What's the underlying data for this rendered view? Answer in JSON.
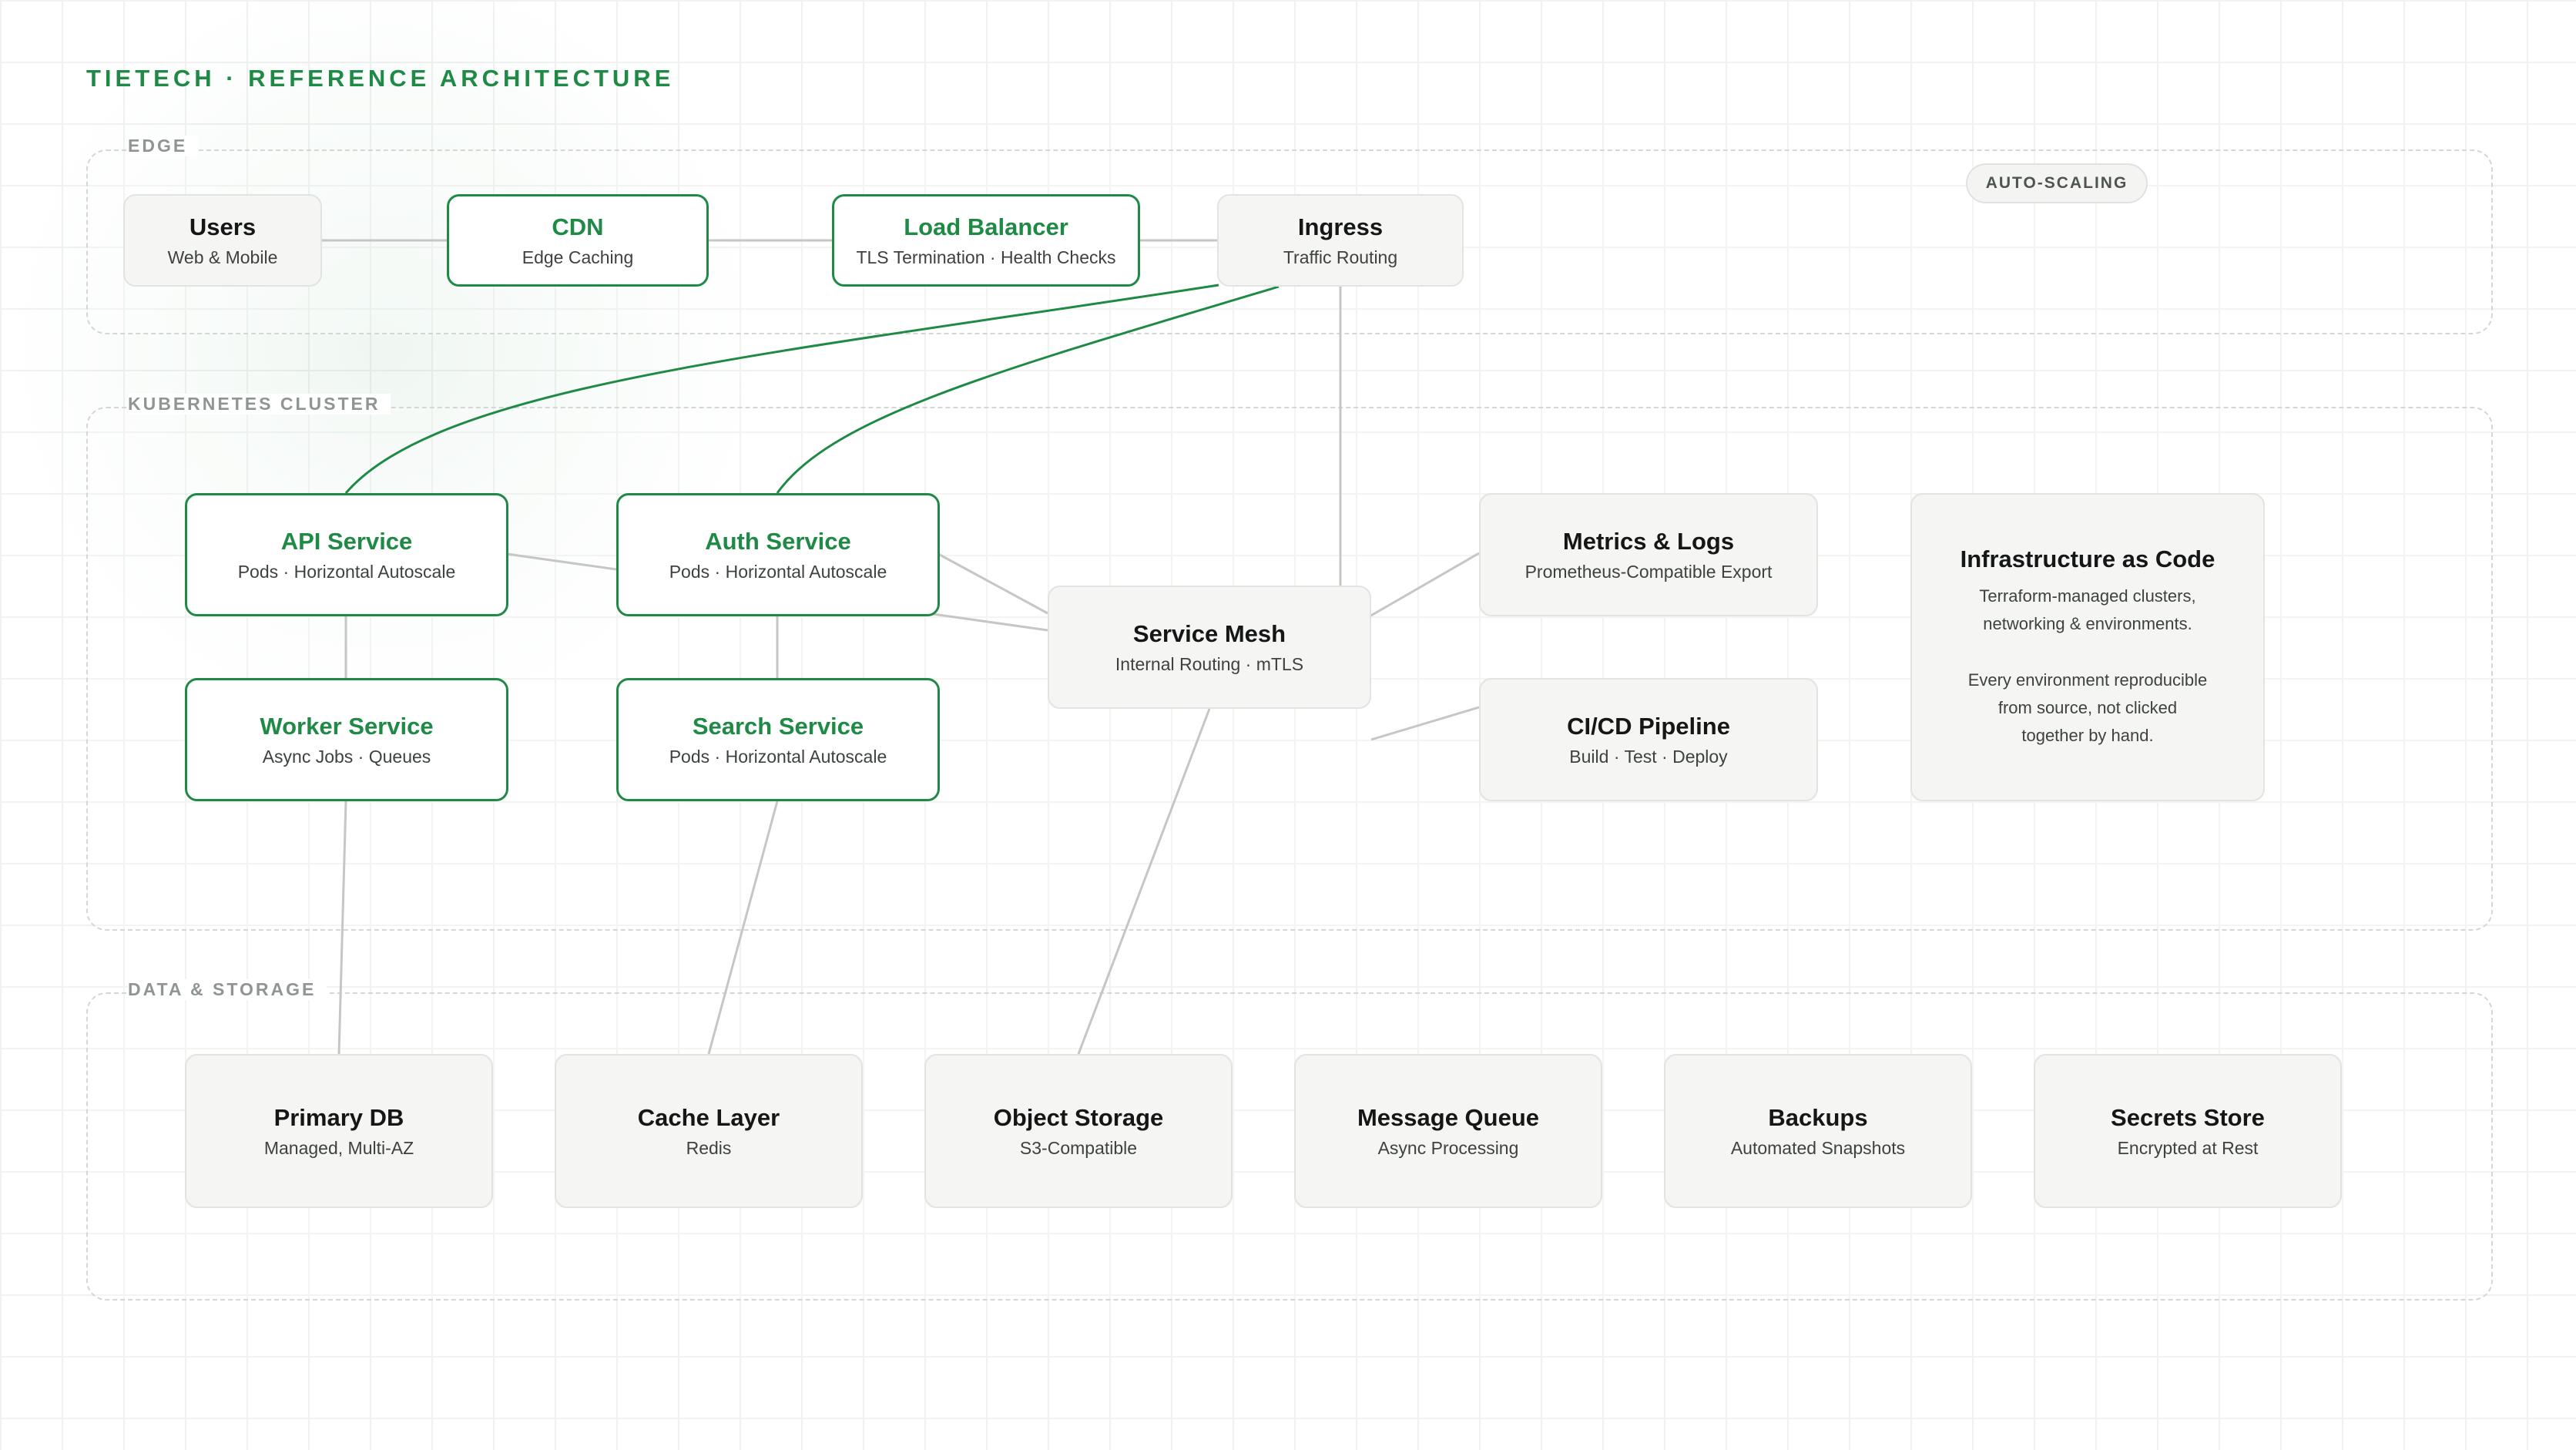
{
  "title": "TIETECH · REFERENCE ARCHITECTURE",
  "colors": {
    "accent": "#1f8a46",
    "connector": "#c4c7c4",
    "node_fill": "#f5f6f4"
  },
  "zones": {
    "edge": "EDGE",
    "cluster": "KUBERNETES CLUSTER",
    "storage": "DATA & STORAGE"
  },
  "badge": "AUTO-SCALING",
  "nodes": {
    "users": {
      "title": "Users",
      "sub": "Web & Mobile"
    },
    "cdn": {
      "title": "CDN",
      "sub": "Edge Caching"
    },
    "lb": {
      "title": "Load Balancer",
      "sub": "TLS Termination · Health Checks"
    },
    "ingress": {
      "title": "Ingress",
      "sub": "Traffic Routing"
    },
    "api": {
      "title": "API Service",
      "sub": "Pods · Horizontal Autoscale"
    },
    "auth": {
      "title": "Auth Service",
      "sub": "Pods · Horizontal Autoscale"
    },
    "worker": {
      "title": "Worker Service",
      "sub": "Async Jobs · Queues"
    },
    "search": {
      "title": "Search Service",
      "sub": "Pods · Horizontal Autoscale"
    },
    "mesh": {
      "title": "Service Mesh",
      "sub": "Internal Routing · mTLS"
    },
    "metrics": {
      "title": "Metrics & Logs",
      "sub": "Prometheus-Compatible Export"
    },
    "cicd": {
      "title": "CI/CD Pipeline",
      "sub": "Build · Test · Deploy"
    },
    "iac": {
      "title": "Infrastructure as Code",
      "desc": "Terraform-managed clusters,\nnetworking & environments.\n\nEvery environment reproducible\nfrom source, not clicked\ntogether by hand."
    },
    "db": {
      "title": "Primary DB",
      "sub": "Managed, Multi-AZ"
    },
    "cache": {
      "title": "Cache Layer",
      "sub": "Redis"
    },
    "objstore": {
      "title": "Object Storage",
      "sub": "S3-Compatible"
    },
    "mq": {
      "title": "Message Queue",
      "sub": "Async Processing"
    },
    "backups": {
      "title": "Backups",
      "sub": "Automated Snapshots"
    },
    "secrets": {
      "title": "Secrets Store",
      "sub": "Encrypted at Rest"
    }
  }
}
